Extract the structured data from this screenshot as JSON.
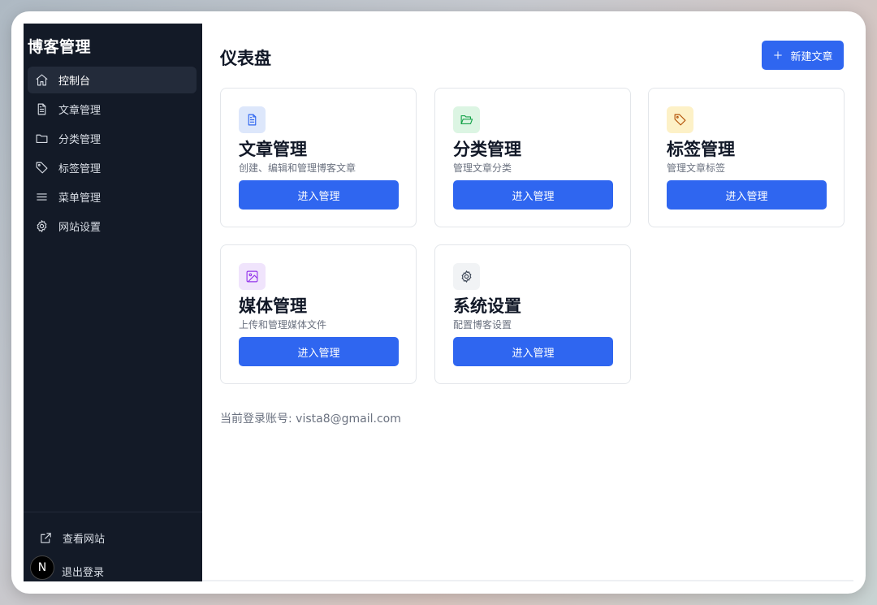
{
  "sidebar": {
    "brand": "博客管理",
    "items": [
      {
        "label": "控制台",
        "icon": "home-icon",
        "active": true
      },
      {
        "label": "文章管理",
        "icon": "file-text-icon"
      },
      {
        "label": "分类管理",
        "icon": "folder-icon"
      },
      {
        "label": "标签管理",
        "icon": "tag-icon"
      },
      {
        "label": "菜单管理",
        "icon": "menu-icon"
      },
      {
        "label": "网站设置",
        "icon": "gear-icon"
      }
    ],
    "footer": {
      "view_site": "查看网站",
      "logout": "退出登录",
      "badge_letter": "N"
    }
  },
  "main": {
    "title": "仪表盘",
    "new_post_label": "新建文章",
    "cards": [
      {
        "title": "文章管理",
        "desc": "创建、编辑和管理博客文章",
        "button": "进入管理",
        "icon": "file-text-icon",
        "icon_bg": "#dde7fb",
        "icon_color": "#2f66f0"
      },
      {
        "title": "分类管理",
        "desc": "管理文章分类",
        "button": "进入管理",
        "icon": "folder-open-icon",
        "icon_bg": "#dcf5e3",
        "icon_color": "#16a34a"
      },
      {
        "title": "标签管理",
        "desc": "管理文章标签",
        "button": "进入管理",
        "icon": "tag-icon",
        "icon_bg": "#fdf1c7",
        "icon_color": "#b45309"
      },
      {
        "title": "媒体管理",
        "desc": "上传和管理媒体文件",
        "button": "进入管理",
        "icon": "image-icon",
        "icon_bg": "#f0e4fc",
        "icon_color": "#9333ea"
      },
      {
        "title": "系统设置",
        "desc": "配置博客设置",
        "button": "进入管理",
        "icon": "gear-icon",
        "icon_bg": "#f1f3f5",
        "icon_color": "#374151"
      }
    ],
    "account_text": "当前登录账号: vista8@gmail.com"
  },
  "colors": {
    "accent": "#2f66f0",
    "sidebar_bg": "#131a27"
  }
}
